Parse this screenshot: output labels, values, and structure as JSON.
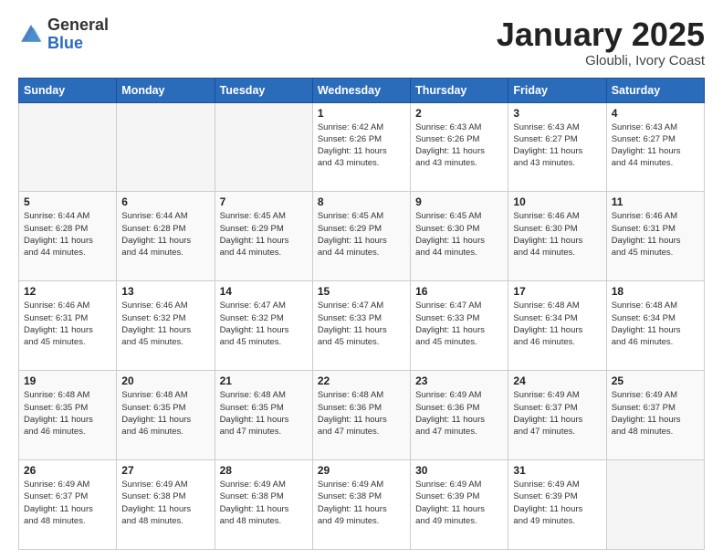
{
  "header": {
    "logo_general": "General",
    "logo_blue": "Blue",
    "title": "January 2025",
    "subtitle": "Gloubli, Ivory Coast"
  },
  "weekdays": [
    "Sunday",
    "Monday",
    "Tuesday",
    "Wednesday",
    "Thursday",
    "Friday",
    "Saturday"
  ],
  "weeks": [
    [
      {
        "day": "",
        "info": ""
      },
      {
        "day": "",
        "info": ""
      },
      {
        "day": "",
        "info": ""
      },
      {
        "day": "1",
        "info": "Sunrise: 6:42 AM\nSunset: 6:26 PM\nDaylight: 11 hours\nand 43 minutes."
      },
      {
        "day": "2",
        "info": "Sunrise: 6:43 AM\nSunset: 6:26 PM\nDaylight: 11 hours\nand 43 minutes."
      },
      {
        "day": "3",
        "info": "Sunrise: 6:43 AM\nSunset: 6:27 PM\nDaylight: 11 hours\nand 43 minutes."
      },
      {
        "day": "4",
        "info": "Sunrise: 6:43 AM\nSunset: 6:27 PM\nDaylight: 11 hours\nand 44 minutes."
      }
    ],
    [
      {
        "day": "5",
        "info": "Sunrise: 6:44 AM\nSunset: 6:28 PM\nDaylight: 11 hours\nand 44 minutes."
      },
      {
        "day": "6",
        "info": "Sunrise: 6:44 AM\nSunset: 6:28 PM\nDaylight: 11 hours\nand 44 minutes."
      },
      {
        "day": "7",
        "info": "Sunrise: 6:45 AM\nSunset: 6:29 PM\nDaylight: 11 hours\nand 44 minutes."
      },
      {
        "day": "8",
        "info": "Sunrise: 6:45 AM\nSunset: 6:29 PM\nDaylight: 11 hours\nand 44 minutes."
      },
      {
        "day": "9",
        "info": "Sunrise: 6:45 AM\nSunset: 6:30 PM\nDaylight: 11 hours\nand 44 minutes."
      },
      {
        "day": "10",
        "info": "Sunrise: 6:46 AM\nSunset: 6:30 PM\nDaylight: 11 hours\nand 44 minutes."
      },
      {
        "day": "11",
        "info": "Sunrise: 6:46 AM\nSunset: 6:31 PM\nDaylight: 11 hours\nand 45 minutes."
      }
    ],
    [
      {
        "day": "12",
        "info": "Sunrise: 6:46 AM\nSunset: 6:31 PM\nDaylight: 11 hours\nand 45 minutes."
      },
      {
        "day": "13",
        "info": "Sunrise: 6:46 AM\nSunset: 6:32 PM\nDaylight: 11 hours\nand 45 minutes."
      },
      {
        "day": "14",
        "info": "Sunrise: 6:47 AM\nSunset: 6:32 PM\nDaylight: 11 hours\nand 45 minutes."
      },
      {
        "day": "15",
        "info": "Sunrise: 6:47 AM\nSunset: 6:33 PM\nDaylight: 11 hours\nand 45 minutes."
      },
      {
        "day": "16",
        "info": "Sunrise: 6:47 AM\nSunset: 6:33 PM\nDaylight: 11 hours\nand 45 minutes."
      },
      {
        "day": "17",
        "info": "Sunrise: 6:48 AM\nSunset: 6:34 PM\nDaylight: 11 hours\nand 46 minutes."
      },
      {
        "day": "18",
        "info": "Sunrise: 6:48 AM\nSunset: 6:34 PM\nDaylight: 11 hours\nand 46 minutes."
      }
    ],
    [
      {
        "day": "19",
        "info": "Sunrise: 6:48 AM\nSunset: 6:35 PM\nDaylight: 11 hours\nand 46 minutes."
      },
      {
        "day": "20",
        "info": "Sunrise: 6:48 AM\nSunset: 6:35 PM\nDaylight: 11 hours\nand 46 minutes."
      },
      {
        "day": "21",
        "info": "Sunrise: 6:48 AM\nSunset: 6:35 PM\nDaylight: 11 hours\nand 47 minutes."
      },
      {
        "day": "22",
        "info": "Sunrise: 6:48 AM\nSunset: 6:36 PM\nDaylight: 11 hours\nand 47 minutes."
      },
      {
        "day": "23",
        "info": "Sunrise: 6:49 AM\nSunset: 6:36 PM\nDaylight: 11 hours\nand 47 minutes."
      },
      {
        "day": "24",
        "info": "Sunrise: 6:49 AM\nSunset: 6:37 PM\nDaylight: 11 hours\nand 47 minutes."
      },
      {
        "day": "25",
        "info": "Sunrise: 6:49 AM\nSunset: 6:37 PM\nDaylight: 11 hours\nand 48 minutes."
      }
    ],
    [
      {
        "day": "26",
        "info": "Sunrise: 6:49 AM\nSunset: 6:37 PM\nDaylight: 11 hours\nand 48 minutes."
      },
      {
        "day": "27",
        "info": "Sunrise: 6:49 AM\nSunset: 6:38 PM\nDaylight: 11 hours\nand 48 minutes."
      },
      {
        "day": "28",
        "info": "Sunrise: 6:49 AM\nSunset: 6:38 PM\nDaylight: 11 hours\nand 48 minutes."
      },
      {
        "day": "29",
        "info": "Sunrise: 6:49 AM\nSunset: 6:38 PM\nDaylight: 11 hours\nand 49 minutes."
      },
      {
        "day": "30",
        "info": "Sunrise: 6:49 AM\nSunset: 6:39 PM\nDaylight: 11 hours\nand 49 minutes."
      },
      {
        "day": "31",
        "info": "Sunrise: 6:49 AM\nSunset: 6:39 PM\nDaylight: 11 hours\nand 49 minutes."
      },
      {
        "day": "",
        "info": ""
      }
    ]
  ]
}
